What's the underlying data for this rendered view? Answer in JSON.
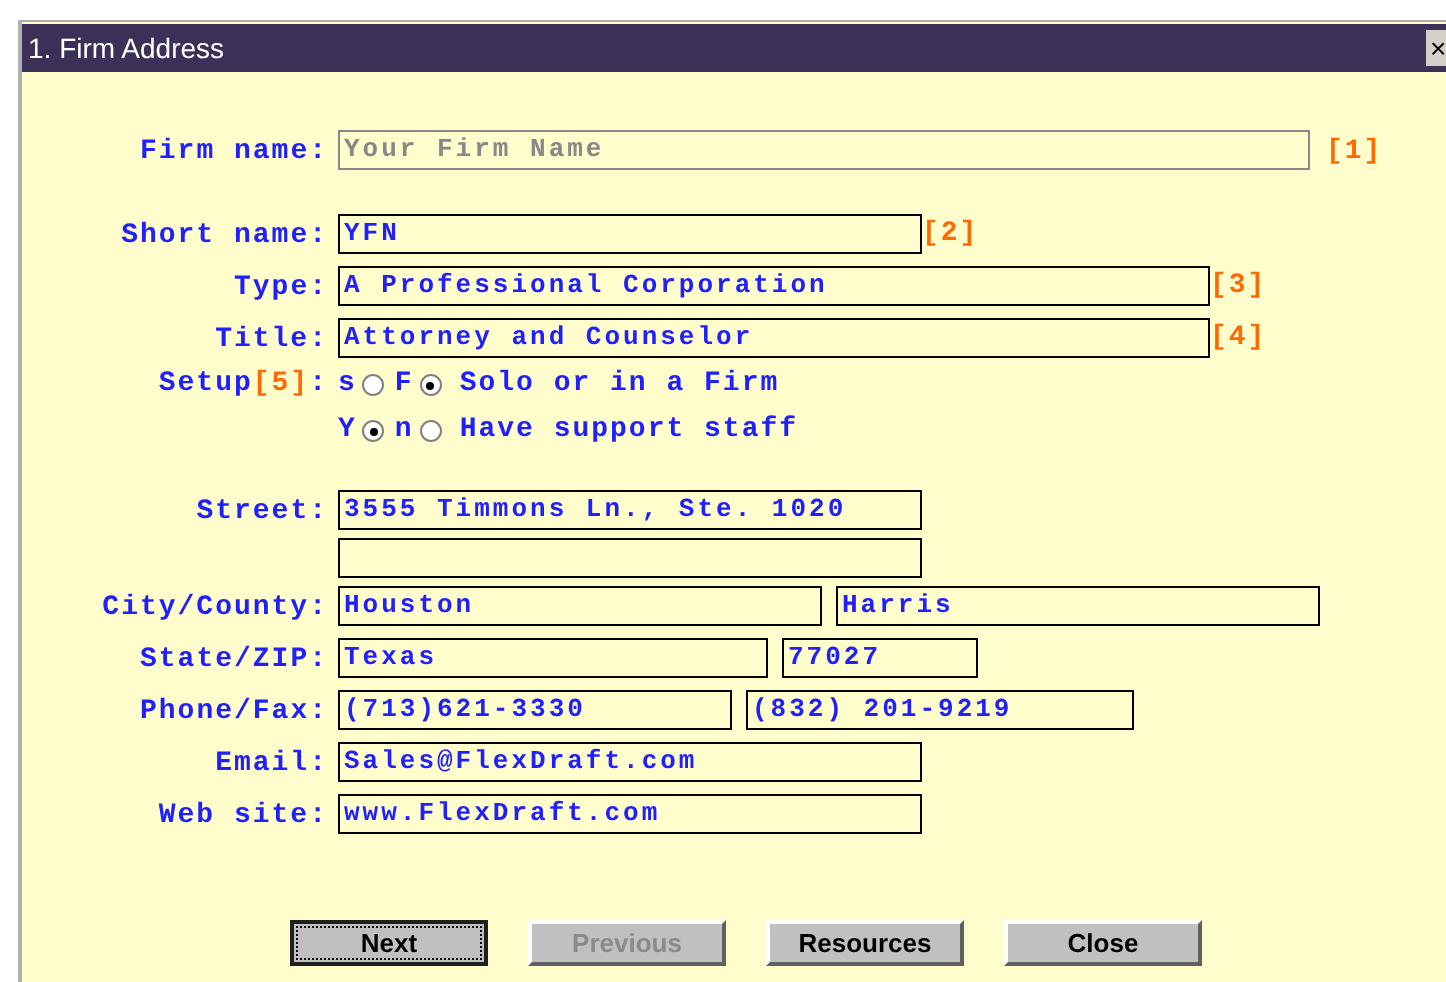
{
  "window": {
    "title": "1. Firm Address",
    "close": "×"
  },
  "firm_name": {
    "label": "Firm name:",
    "placeholder": "Your Firm Name",
    "tag": "[1]"
  },
  "short_name": {
    "label": "Short name:",
    "value": "YFN",
    "tag": "[2]"
  },
  "type": {
    "label": "Type:",
    "value": "A Professional Corporation",
    "tag": "[3]"
  },
  "title": {
    "label": "Title:",
    "value": "Attorney and Counselor",
    "tag": "[4]"
  },
  "setup": {
    "label": "Setup",
    "tag": "[5]",
    "colon": ":",
    "rows": [
      {
        "options": [
          {
            "key": "s",
            "selected": false
          },
          {
            "key": "F",
            "selected": true
          }
        ],
        "text": "Solo or in a Firm"
      },
      {
        "options": [
          {
            "key": "Y",
            "selected": true
          },
          {
            "key": "n",
            "selected": false
          }
        ],
        "text": "Have support staff"
      }
    ]
  },
  "address": [
    {
      "label": "Street:",
      "fields": [
        {
          "value": "3555 Timmons Ln., Ste. 1020"
        }
      ]
    },
    {
      "kind": "blank_line"
    },
    {
      "label": "City/County:",
      "fields": [
        {
          "value": "Houston"
        },
        {
          "value": "Harris"
        }
      ]
    },
    {
      "label": "State/ZIP:",
      "fields": [
        {
          "value": "Texas"
        },
        {
          "value": "77027"
        }
      ]
    },
    {
      "label": "Phone/Fax:",
      "fields": [
        {
          "value": "(713)621-3330"
        },
        {
          "value": "(832) 201-9219"
        }
      ]
    },
    {
      "label": "Email:",
      "fields": [
        {
          "value": "Sales@FlexDraft.com"
        }
      ]
    },
    {
      "label": "Web site:",
      "fields": [
        {
          "value": "www.FlexDraft.com"
        }
      ]
    }
  ],
  "buttons": [
    {
      "label": "Next",
      "focused": true,
      "disabled": false
    },
    {
      "label": "Previous",
      "focused": false,
      "disabled": true
    },
    {
      "label": "Resources",
      "focused": false,
      "disabled": false
    },
    {
      "label": "Close",
      "focused": false,
      "disabled": false
    }
  ]
}
